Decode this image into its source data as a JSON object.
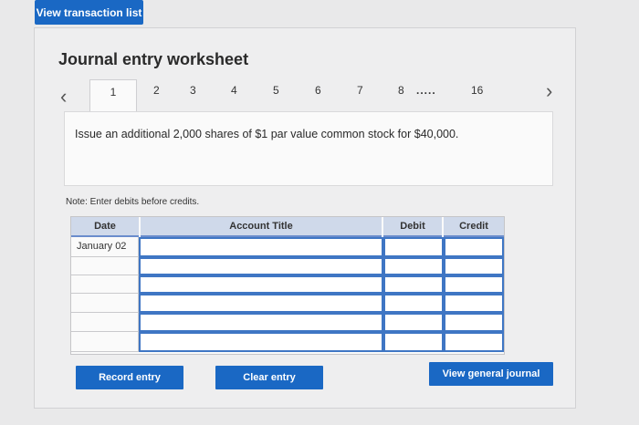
{
  "top_button": "View transaction list",
  "worksheet": {
    "title": "Journal entry worksheet",
    "pages": [
      "1",
      "2",
      "3",
      "4",
      "5",
      "6",
      "7",
      "8"
    ],
    "ellipsis": ".....",
    "last_page": "16",
    "prev_icon": "chevron-left-icon",
    "next_icon": "chevron-right-icon",
    "description": "Issue an additional 2,000 shares of $1 par value common stock for $40,000.",
    "note": "Note: Enter debits before credits."
  },
  "table": {
    "headers": {
      "date": "Date",
      "account": "Account Title",
      "debit": "Debit",
      "credit": "Credit"
    },
    "first_date": "January 02"
  },
  "buttons": {
    "record": "Record entry",
    "clear": "Clear entry",
    "view_journal": "View general journal"
  },
  "colors": {
    "primary": "#1a68c4",
    "header": "#cfd9ea"
  }
}
